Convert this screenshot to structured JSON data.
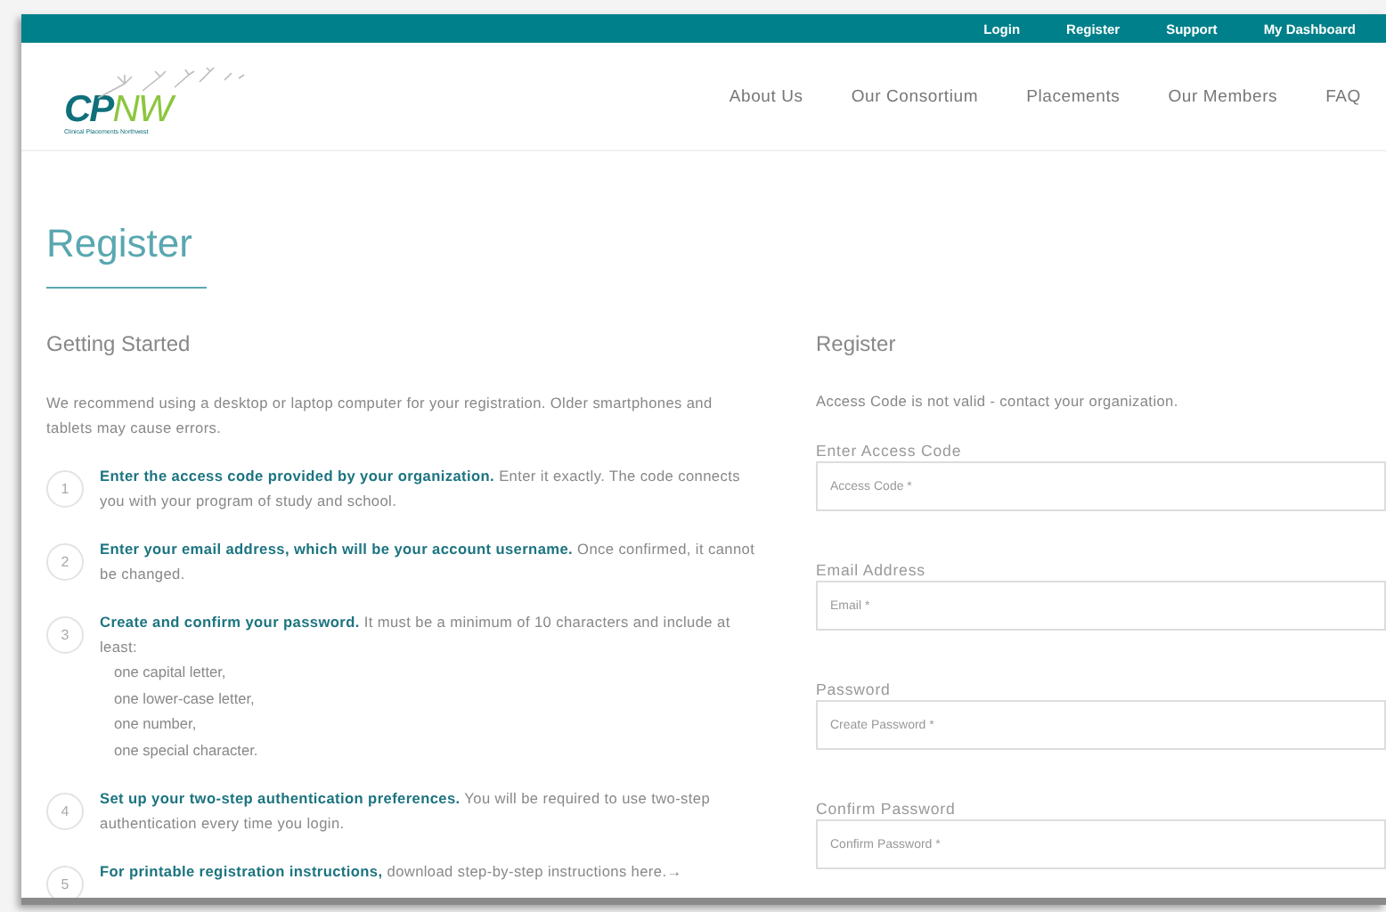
{
  "top_links": [
    {
      "label": "Login"
    },
    {
      "label": "Register"
    },
    {
      "label": "Support"
    },
    {
      "label": "My Dashboard"
    }
  ],
  "logo": {
    "mark": "CP",
    "mark_accent": "NW",
    "tagline": "Clinical Placements Northwest"
  },
  "nav": [
    {
      "label": "About Us"
    },
    {
      "label": "Our Consortium"
    },
    {
      "label": "Placements"
    },
    {
      "label": "Our Members"
    },
    {
      "label": "FAQ"
    }
  ],
  "page_title": "Register",
  "intro": {
    "heading": "Getting Started",
    "text": "We recommend using a desktop or laptop computer for your registration. Older smartphones and tablets may cause errors."
  },
  "steps": [
    {
      "number": "1",
      "text": "**Enter the access code provided by your organization.** Enter it exactly. The code connects you with your program of study and school."
    },
    {
      "number": "2",
      "text": "**Enter your email address, which will be your account username.** Once confirmed, it cannot be changed."
    },
    {
      "number": "3",
      "text": "**Create and confirm your password.** It must be a minimum of 10 characters and include at least:",
      "lines": [
        "one capital letter,",
        "one lower-case letter,",
        "one number,",
        "one special character."
      ]
    },
    {
      "number": "4",
      "text": "**Set up your two-step authentication preferences.** You will be required to use two-step authentication every time you login."
    },
    {
      "number": "5",
      "text": "**For printable registration instructions,** download step-by-step instructions here.→"
    }
  ],
  "form": {
    "heading": "Register",
    "error": "Access Code is not valid - contact your organization.",
    "fields": [
      {
        "label": "Enter Access Code",
        "placeholder": "Access Code *"
      },
      {
        "label": "Email Address",
        "placeholder": "Email *"
      },
      {
        "label": "Password",
        "placeholder": "Create Password *"
      },
      {
        "label": "Confirm Password",
        "placeholder": "Confirm Password *"
      }
    ]
  }
}
